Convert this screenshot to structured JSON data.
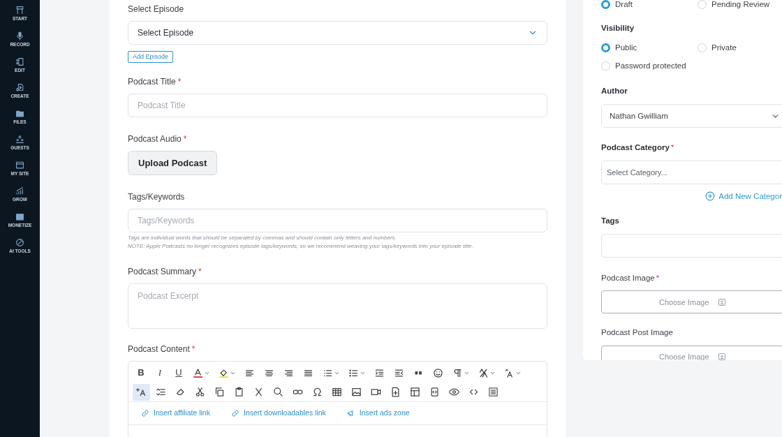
{
  "sidebar": {
    "items": [
      {
        "label": "START"
      },
      {
        "label": "RECORD"
      },
      {
        "label": "EDIT"
      },
      {
        "label": "CREATE"
      },
      {
        "label": "FILES"
      },
      {
        "label": "GUESTS"
      },
      {
        "label": "MY SITE"
      },
      {
        "label": "GROW"
      },
      {
        "label": "MONETIZE"
      },
      {
        "label": "AI TOOLS"
      }
    ]
  },
  "form": {
    "episode": {
      "label": "Select Episode",
      "value": "Select Episode",
      "add_button": "Add Episode"
    },
    "title": {
      "label": "Podcast Title",
      "required_mark": "*",
      "placeholder": "Podcast Title"
    },
    "audio": {
      "label": "Podcast Audio",
      "required_mark": "*",
      "button": "Upload Podcast"
    },
    "tags": {
      "label": "Tags/Keywords",
      "placeholder": "Tags/Keywords",
      "help": [
        "Tags are individual words that should be separated by commas and should contain only letters and numbers.",
        "NOTE: Apple Podcasts no longer recognizes episode tags/keywords, so we recommend weaving your tags/keywords into your episode title."
      ]
    },
    "summary": {
      "label": "Podcast Summary",
      "required_mark": "*",
      "placeholder": "Podcast Excerpt"
    },
    "content": {
      "label": "Podcast Content",
      "required_mark": "*",
      "toolbar_letters": [
        "B",
        "I",
        "U"
      ],
      "links": [
        "Insert affiliate link",
        "Insert downloadables link",
        "Insert ads zone"
      ]
    }
  },
  "side": {
    "status": {
      "options": [
        {
          "label": "Draft",
          "selected": true
        },
        {
          "label": "Pending Review",
          "selected": false
        }
      ]
    },
    "visibility": {
      "label": "Visibility",
      "options": [
        {
          "label": "Public",
          "selected": true
        },
        {
          "label": "Private",
          "selected": false
        },
        {
          "label": "Password protected",
          "selected": false
        }
      ]
    },
    "author": {
      "label": "Author",
      "value": "Nathan Gwilliam"
    },
    "category": {
      "label": "Podcast Category",
      "required_mark": "*",
      "placeholder": "Select Category...",
      "add_link": "Add New Categor"
    },
    "tags": {
      "label": "Tags"
    },
    "image": {
      "label": "Podcast Image",
      "required_mark": "*",
      "button": "Choose Image"
    },
    "post_image": {
      "label": "Podcast Post Image",
      "button": "Choose Image"
    }
  }
}
